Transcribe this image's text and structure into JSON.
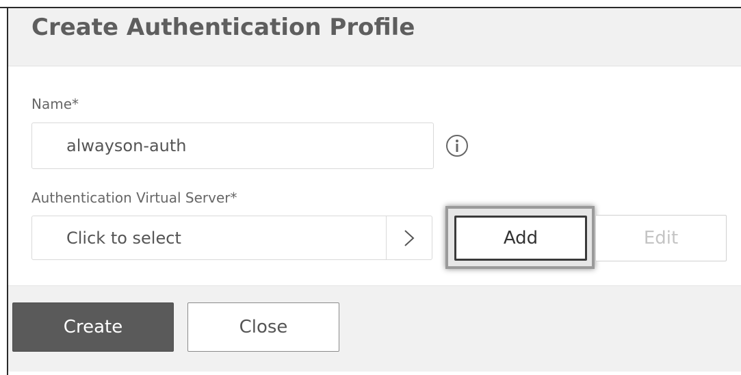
{
  "dialog": {
    "title": "Create Authentication Profile"
  },
  "form": {
    "name_label": "Name*",
    "name_value": "alwayson-auth",
    "server_label": "Authentication Virtual Server*",
    "server_placeholder": "Click to select"
  },
  "buttons": {
    "add_label": "Add",
    "edit_label": "Edit",
    "create_label": "Create",
    "close_label": "Close"
  },
  "icons": {
    "info": "info-icon",
    "select_arrow": "chevron-right-icon"
  },
  "colors": {
    "primary_button": "#5a5a5a",
    "header_bg": "#f1f1f1",
    "disabled_text": "#c4c4c4"
  }
}
